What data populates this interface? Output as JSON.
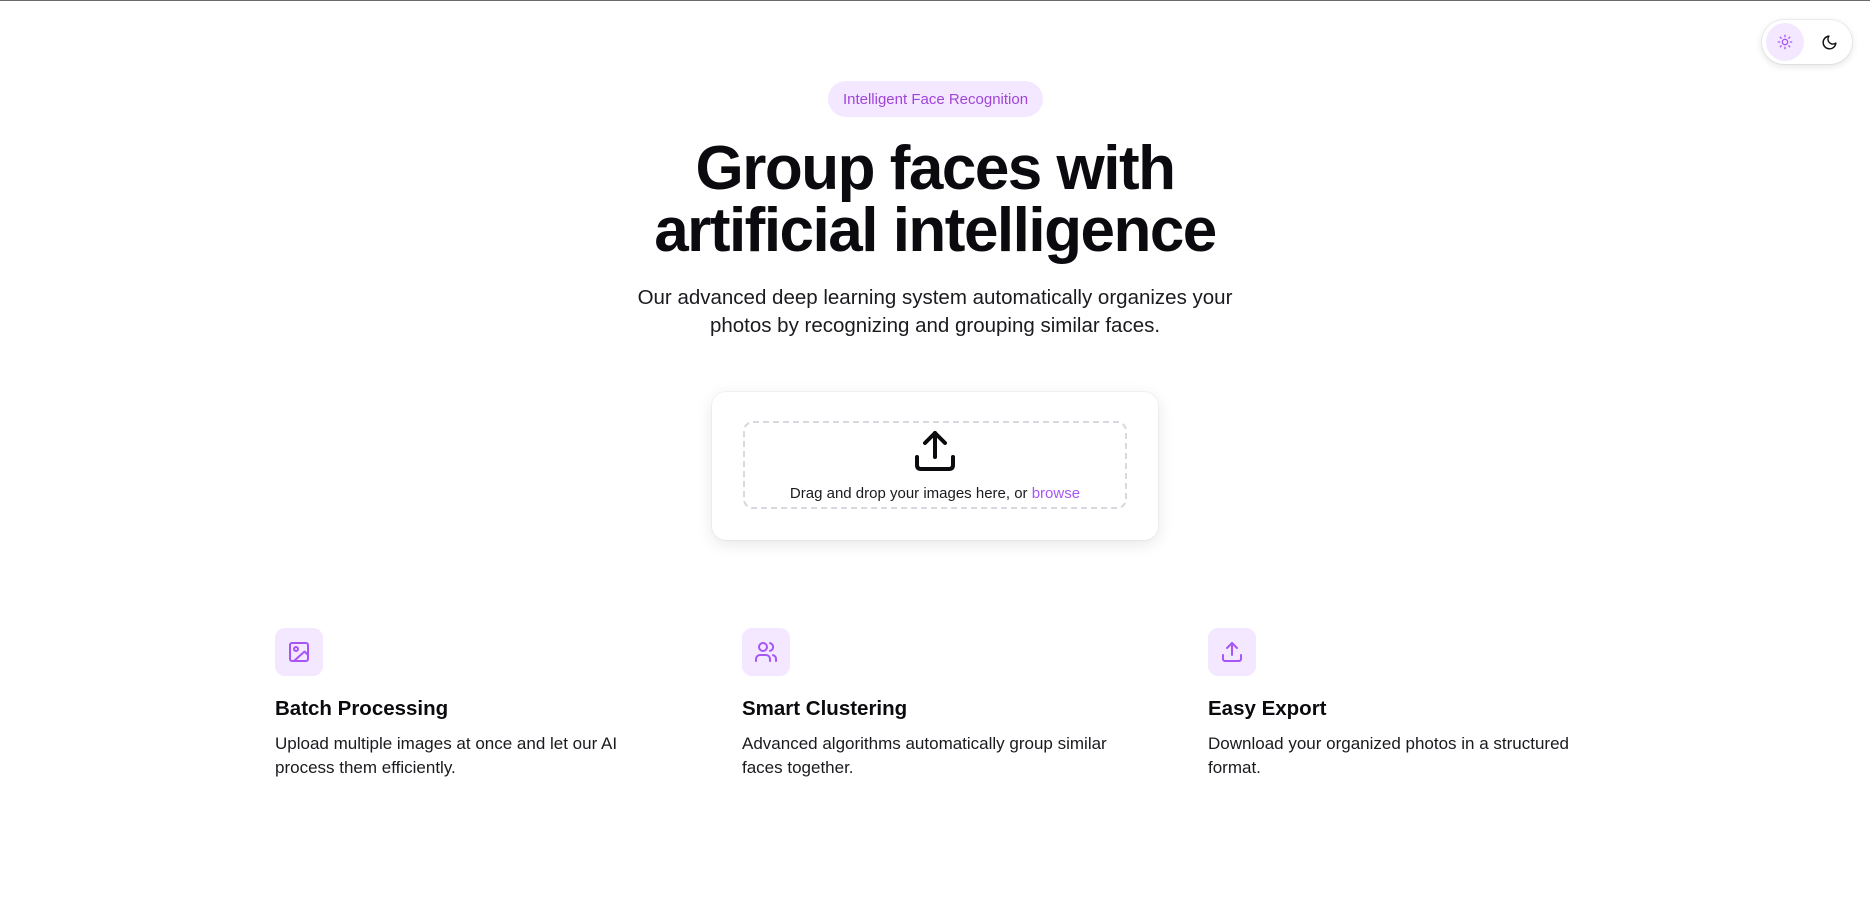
{
  "theme_toggle": {
    "light_icon": "sun-icon",
    "dark_icon": "moon-icon",
    "active": "light"
  },
  "badge": "Intelligent Face Recognition",
  "hero": {
    "title_line1": "Group faces with",
    "title_line2": "artificial intelligence",
    "subtitle": "Our advanced deep learning system automatically organizes your photos by recognizing and grouping similar faces."
  },
  "upload": {
    "icon": "upload-icon",
    "prompt": "Drag and drop your images here, or ",
    "browse_label": "browse"
  },
  "features": [
    {
      "icon": "image-icon",
      "title": "Batch Processing",
      "description": "Upload multiple images at once and let our AI process them efficiently."
    },
    {
      "icon": "users-icon",
      "title": "Smart Clustering",
      "description": "Advanced algorithms automatically group similar faces together."
    },
    {
      "icon": "upload-icon",
      "title": "Easy Export",
      "description": "Download your organized photos in a structured format."
    }
  ],
  "colors": {
    "accent": "#a855f7",
    "accent_soft": "#f3e8ff",
    "text": "#0b0b0f"
  }
}
